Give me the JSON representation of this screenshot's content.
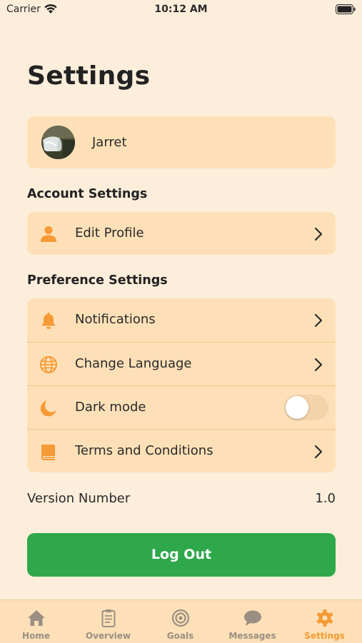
{
  "status_bar": {
    "carrier": "Carrier",
    "time": "10:12 AM"
  },
  "page_title": "Settings",
  "profile": {
    "name": "Jarret"
  },
  "account_section": {
    "title": "Account Settings",
    "items": [
      {
        "label": "Edit Profile",
        "icon": "person-icon"
      }
    ]
  },
  "preference_section": {
    "title": "Preference Settings",
    "items": [
      {
        "label": "Notifications",
        "icon": "bell-icon"
      },
      {
        "label": "Change Language",
        "icon": "globe-icon"
      },
      {
        "label": "Dark mode",
        "icon": "moon-icon",
        "toggle": false
      },
      {
        "label": "Terms and Conditions",
        "icon": "book-icon"
      }
    ]
  },
  "version": {
    "label": "Version Number",
    "value": "1.0"
  },
  "logout_label": "Log Out",
  "tabs": [
    {
      "label": "Home",
      "icon": "home-icon"
    },
    {
      "label": "Overview",
      "icon": "clipboard-icon"
    },
    {
      "label": "Goals",
      "icon": "target-icon"
    },
    {
      "label": "Messages",
      "icon": "chat-bubble-icon"
    },
    {
      "label": "Settings",
      "icon": "gear-icon",
      "active": true
    }
  ],
  "colors": {
    "background": "#fdeedb",
    "card": "#fde0b7",
    "accent": "#f59a34",
    "logout": "#2ea84b",
    "tab_inactive": "#9a8f82"
  }
}
